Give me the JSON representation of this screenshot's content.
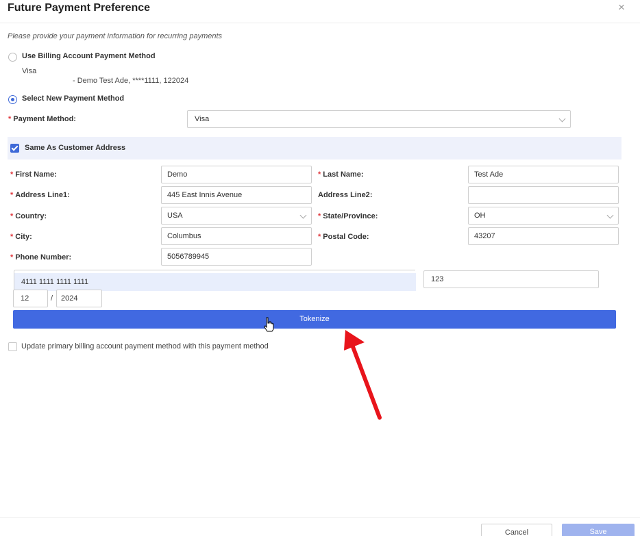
{
  "dialog": {
    "title": "Future Payment Preference",
    "close_label": "×"
  },
  "hint": "Please provide your payment information for recurring payments",
  "billing_option": {
    "label": "Use Billing Account Payment Method",
    "card_type": "Visa",
    "card_detail": "- Demo Test Ade, ****1111, 122024"
  },
  "new_option": {
    "label": "Select New Payment Method"
  },
  "payment_method": {
    "label": "Payment Method",
    "value": "Visa"
  },
  "same_as_customer": {
    "label": "Same As Customer Address",
    "checked": true
  },
  "form": {
    "first_name": {
      "label": "First Name",
      "value": "Demo"
    },
    "last_name": {
      "label": "Last Name",
      "value": "Test Ade"
    },
    "address1": {
      "label": "Address Line1",
      "value": "445 East Innis Avenue"
    },
    "address2": {
      "label": "Address Line2",
      "value": ""
    },
    "country": {
      "label": "Country",
      "value": "USA"
    },
    "state": {
      "label": "State/Province",
      "value": "OH"
    },
    "city": {
      "label": "City",
      "value": "Columbus"
    },
    "postal": {
      "label": "Postal Code",
      "value": "43207"
    },
    "phone": {
      "label": "Phone Number",
      "value": "5056789945"
    }
  },
  "card": {
    "number": "4111 1111 1111 1111",
    "cvv": "123",
    "exp_month": "12",
    "exp_separator": "/",
    "exp_year": "2024"
  },
  "tokenize_label": "Tokenize",
  "update_primary_label": "Update primary billing account payment method with this payment method",
  "footer": {
    "cancel_label": "Cancel",
    "save_label": "Save"
  },
  "colors": {
    "accent": "#4169e1",
    "required": "#e0393e",
    "annotation_arrow": "#e8141b"
  },
  "label_suffix": ":"
}
